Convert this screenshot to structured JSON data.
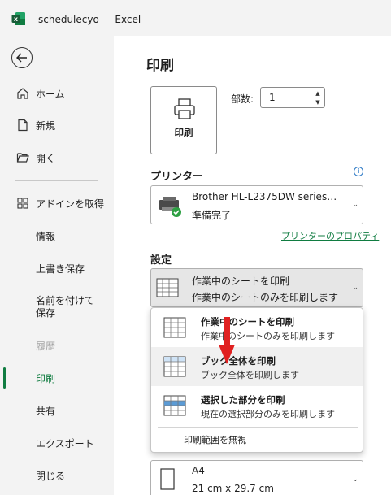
{
  "window": {
    "title": "schedulecyo  -  Excel"
  },
  "sidebar": {
    "back_icon": "back-arrow-icon",
    "items": [
      {
        "label": "ホーム",
        "icon": "home-icon"
      },
      {
        "label": "新規",
        "icon": "new-document-icon"
      },
      {
        "label": "開く",
        "icon": "folder-open-icon"
      },
      {
        "label": "アドインを取得",
        "icon": "grid-addin-icon"
      },
      {
        "label": "情報"
      },
      {
        "label": "上書き保存"
      },
      {
        "label": "名前を付けて保存"
      },
      {
        "label": "履歴",
        "disabled": true
      },
      {
        "label": "印刷",
        "active": true
      },
      {
        "label": "共有"
      },
      {
        "label": "エクスポート"
      },
      {
        "label": "閉じる"
      }
    ]
  },
  "main": {
    "title": "印刷",
    "print_button": "印刷",
    "copies_label": "部数:",
    "copies_value": "1",
    "printer_heading": "プリンター",
    "printer_name": "Brother HL-L2375DW series…",
    "printer_status": "準備完了",
    "printer_properties": "プリンターのプロパティ",
    "settings_heading": "設定",
    "settings_selected_title": "作業中のシートを印刷",
    "settings_selected_desc": "作業中のシートのみを印刷します",
    "menu": {
      "items": [
        {
          "title": "作業中のシートを印刷",
          "desc": "作業中のシートのみを印刷します"
        },
        {
          "title": "ブック全体を印刷",
          "desc": "ブック全体を印刷します"
        },
        {
          "title": "選択した部分を印刷",
          "desc": "現在の選択部分のみを印刷します"
        }
      ],
      "ignore_area": "印刷範囲を無視"
    },
    "paper_size": "A4",
    "paper_dimensions": "21 cm x 29.7 cm"
  },
  "colors": {
    "accent": "#107c41",
    "arrow": "#e02020"
  }
}
